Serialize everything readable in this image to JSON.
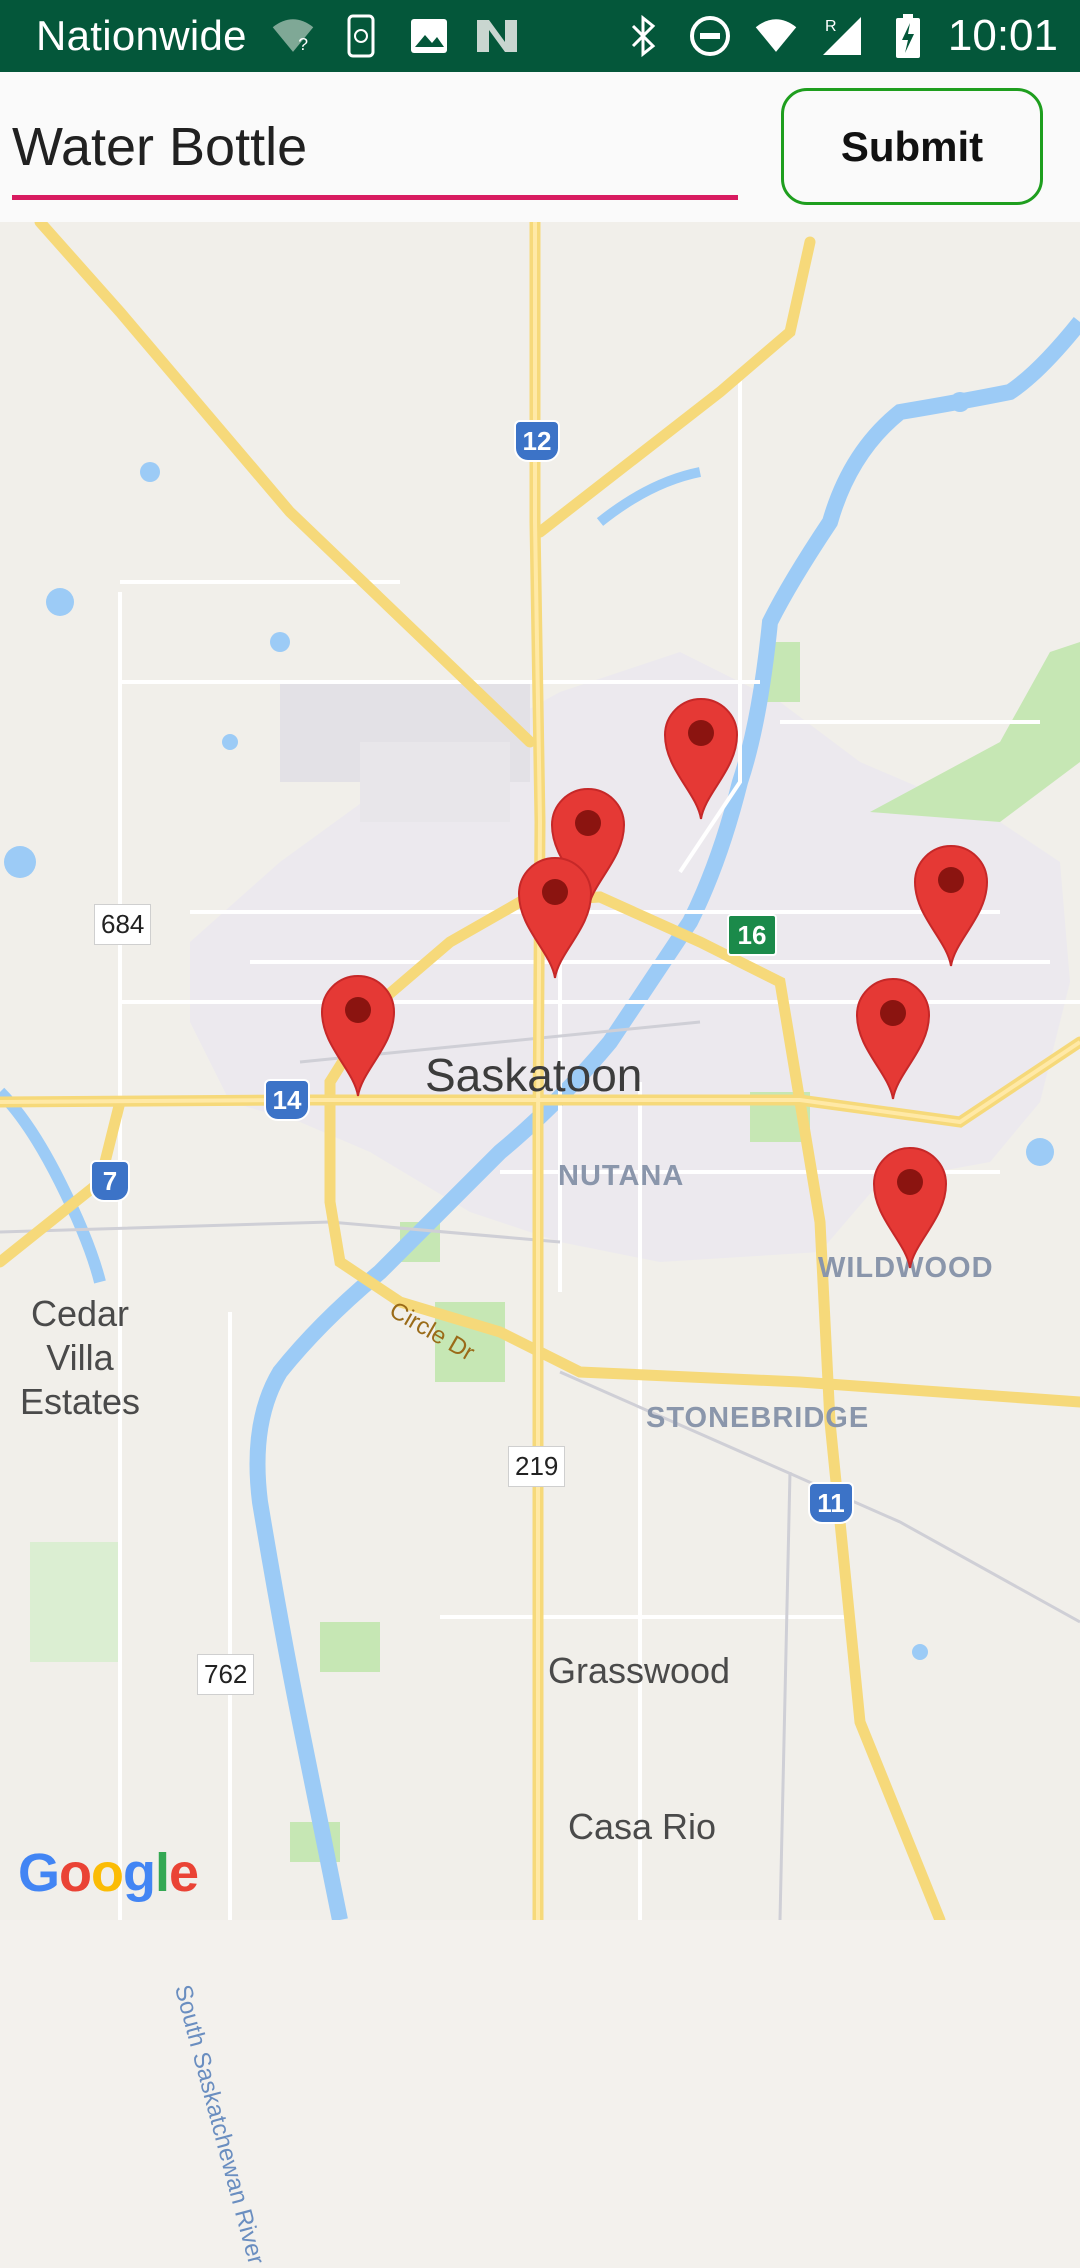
{
  "status_bar": {
    "carrier": "Nationwide",
    "time": "10:01",
    "icons": [
      "wifi-question-icon",
      "phone-sync-icon",
      "image-icon",
      "n-logo-icon",
      "bluetooth-icon",
      "do-not-disturb-icon",
      "wifi-icon",
      "signal-icon",
      "battery-charging-icon"
    ]
  },
  "search": {
    "value": "Water Bottle"
  },
  "submit_button": {
    "label": "Submit"
  },
  "colors": {
    "status_bar": "#04573a",
    "input_underline": "#d81b60",
    "submit_border": "#1e9e1e",
    "pin": "#e53935",
    "pin_dot": "#8b1410"
  },
  "map": {
    "city": "Saskatoon",
    "neighborhoods": [
      "NUTANA",
      "WILDWOOD",
      "STONEBRIDGE"
    ],
    "places": [
      "Cedar Villa Estates",
      "Grasswood",
      "Casa Rio"
    ],
    "road_labels": [
      "684",
      "219",
      "762"
    ],
    "highway_shields": [
      "12",
      "14",
      "7",
      "11",
      "16"
    ],
    "street_label": "Circle Dr",
    "river_label": "South Saskatchewan River",
    "logo": "Google",
    "marker_count": 7
  }
}
